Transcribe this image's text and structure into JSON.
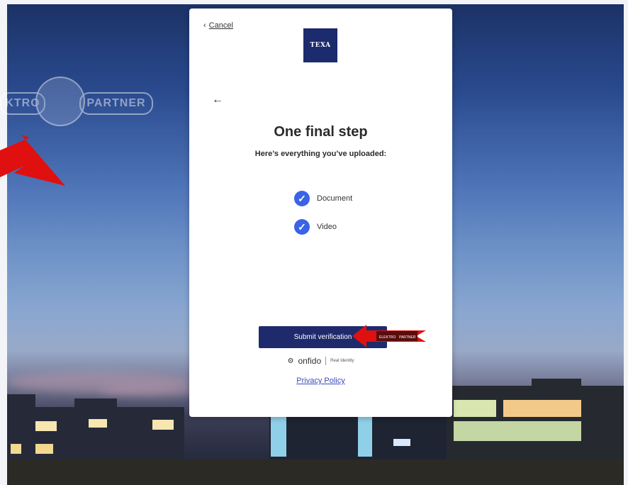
{
  "card": {
    "cancel_label": "Cancel",
    "logo_text": "TEXA",
    "title": "One final step",
    "subtitle": "Here’s everything you’ve uploaded:",
    "uploads": [
      {
        "label": "Document"
      },
      {
        "label": "Video"
      }
    ],
    "submit_label": "Submit verification",
    "footer_brand": "onfido",
    "footer_tagline": "Real Identity",
    "privacy_label": "Privacy Policy"
  },
  "watermark": {
    "left_text": "KTRO",
    "right_text": "PARTNER",
    "badge_left_text": "ELEKTRO",
    "badge_right_text": "PARTNER"
  },
  "colors": {
    "accent": "#3a64e6",
    "button": "#1f2a6d",
    "logo_bg": "#1c2b6e",
    "link": "#3a4bbd",
    "arrow_red": "#e01010"
  }
}
